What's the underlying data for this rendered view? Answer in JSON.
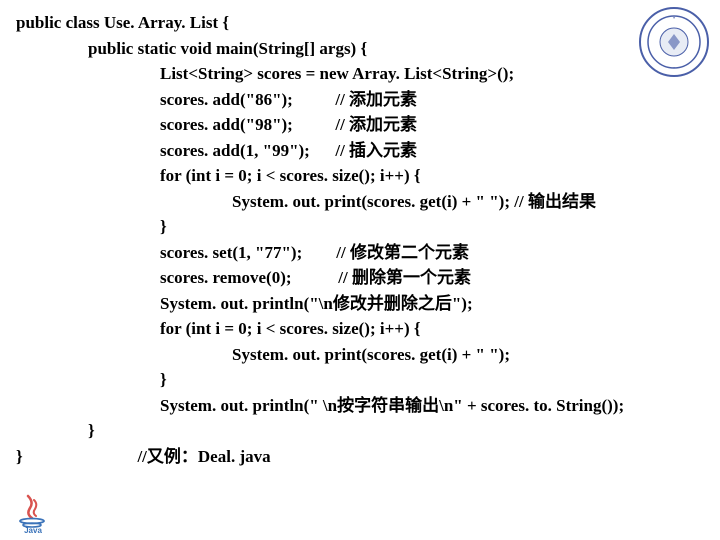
{
  "code": {
    "l1": "public class Use. Array. List {",
    "l2": "public static void main(String[] args) {",
    "l3": "List<String> scores = new Array. List<String>();",
    "l4a": "scores. add(\"86\");",
    "l4b": "// 添加元素",
    "l5a": "scores. add(\"98\");",
    "l5b": "// 添加元素",
    "l6a": "scores. add(1, \"99\");",
    "l6b": "// 插入元素",
    "l7": "for (int i = 0; i < scores. size(); i++) {",
    "l8": "System. out. print(scores. get(i) + \" \"); // 输出结果",
    "l9": "}",
    "l10a": "scores. set(1, \"77\");",
    "l10b": "// 修改第二个元素",
    "l11a": "scores. remove(0);",
    "l11b": "// 删除第一个元素",
    "l12": "System. out. println(\"\\n修改并删除之后\");",
    "l13": "for (int i = 0; i < scores. size(); i++) {",
    "l14": "System. out. print(scores. get(i) + \" \");",
    "l15": "}",
    "l16": "System. out. println(\" \\n按字符串输出\\n\" + scores. to. String());",
    "l17": "}",
    "l18": "}",
    "l19": "//又例：Deal. java"
  },
  "logo_alt": "university-seal",
  "java_alt": "java-logo"
}
